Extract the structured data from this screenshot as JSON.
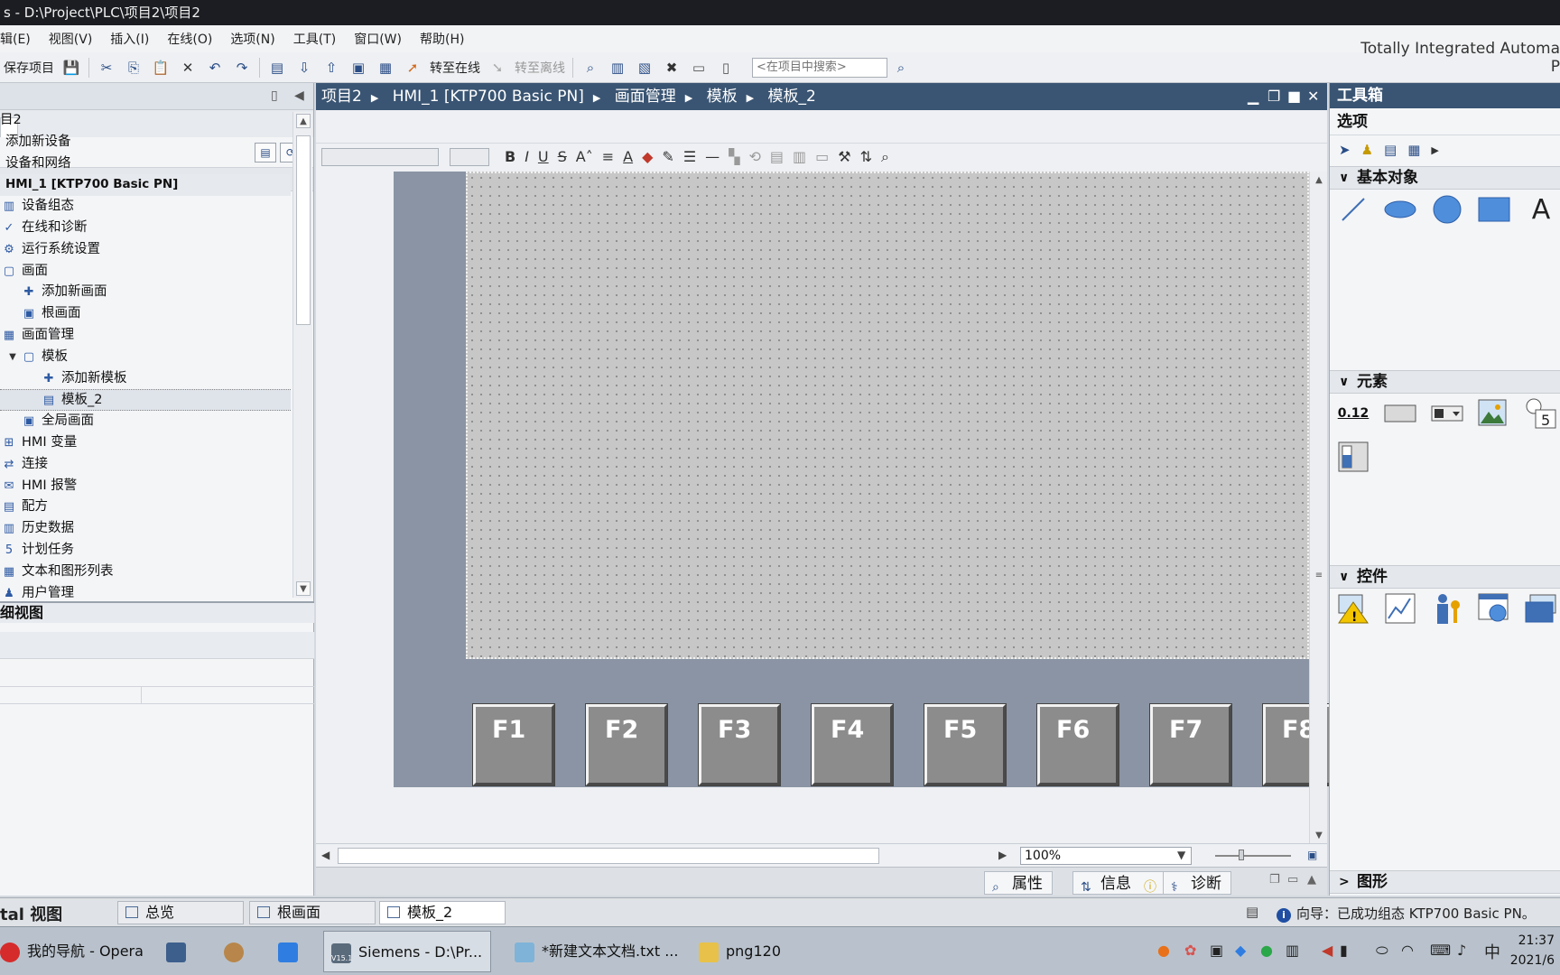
{
  "titlebar": {
    "prefix": "s  -  ",
    "path": "D:\\Project\\PLC\\项目2\\项目2"
  },
  "brand": {
    "line1": "Totally Integrated Automa",
    "line2": "P"
  },
  "menu": [
    "辑(E)",
    "视图(V)",
    "插入(I)",
    "在线(O)",
    "选项(N)",
    "工具(T)",
    "窗口(W)",
    "帮助(H)"
  ],
  "toolbar": {
    "save": "保存项目",
    "go_online": "转至在线",
    "go_offline": "转至离线",
    "search_placeholder": "<在项目中搜索>"
  },
  "tree": {
    "root": "目2",
    "items": [
      {
        "label": "添加新设备",
        "indent": 0,
        "icon": "add-device-icon"
      },
      {
        "label": "设备和网络",
        "indent": 0,
        "icon": "network-icon"
      },
      {
        "label": "HMI_1 [KTP700 Basic PN]",
        "indent": 0,
        "icon": "hmi-icon",
        "header": true
      },
      {
        "label": "设备组态",
        "indent": 1,
        "icon": "device-config-icon"
      },
      {
        "label": "在线和诊断",
        "indent": 1,
        "icon": "diagnostics-icon"
      },
      {
        "label": "运行系统设置",
        "indent": 1,
        "icon": "runtime-settings-icon"
      },
      {
        "label": "画面",
        "indent": 1,
        "icon": "folder-icon"
      },
      {
        "label": "添加新画面",
        "indent": 2,
        "icon": "add-screen-icon"
      },
      {
        "label": "根画面",
        "indent": 2,
        "icon": "screen-icon"
      },
      {
        "label": "画面管理",
        "indent": 1,
        "icon": "screen-management-icon"
      },
      {
        "label": "模板",
        "indent": 2,
        "icon": "template-folder-icon",
        "expanded": true
      },
      {
        "label": "添加新模板",
        "indent": 3,
        "icon": "add-template-icon"
      },
      {
        "label": "模板_2",
        "indent": 3,
        "icon": "template-icon",
        "selected": true
      },
      {
        "label": "全局画面",
        "indent": 2,
        "icon": "global-screen-icon"
      },
      {
        "label": "HMI 变量",
        "indent": 1,
        "icon": "hmi-tags-icon"
      },
      {
        "label": "连接",
        "indent": 1,
        "icon": "connection-icon"
      },
      {
        "label": "HMI 报警",
        "indent": 1,
        "icon": "alarm-icon"
      },
      {
        "label": "配方",
        "indent": 1,
        "icon": "recipe-icon"
      },
      {
        "label": "历史数据",
        "indent": 1,
        "icon": "historical-data-icon"
      },
      {
        "label": "计划任务",
        "indent": 1,
        "icon": "scheduler-icon"
      },
      {
        "label": "文本和图形列表",
        "indent": 1,
        "icon": "text-graphic-list-icon"
      },
      {
        "label": "用户管理",
        "indent": 1,
        "icon": "user-management-icon"
      }
    ]
  },
  "detail_view": {
    "title": "细视图"
  },
  "breadcrumb": [
    "项目2",
    "HMI_1 [KTP700 Basic PN]",
    "画面管理",
    "模板",
    "模板_2"
  ],
  "fkeys": [
    "F1",
    "F2",
    "F3",
    "F4",
    "F5",
    "F6",
    "F7",
    "F8"
  ],
  "zoom": {
    "value": "100%"
  },
  "inspector_tabs": {
    "properties": "属性",
    "info": "信息",
    "diagnostics": "诊断"
  },
  "toolbox": {
    "title": "工具箱",
    "options": "选项",
    "sections": {
      "basic": "基本对象",
      "elements": "元素",
      "controls": "控件",
      "graphics": "图形"
    },
    "text_tool": "A",
    "io_field": "0.12",
    "clock_digit": "5"
  },
  "statusbar": {
    "portal": "tal 视图",
    "tabs": [
      "总览",
      "根画面",
      "模板_2"
    ],
    "message": "向导：已成功组态 KTP700 Basic PN。"
  },
  "taskbar": {
    "items": [
      "我的导航 - Opera",
      "Siemens  -  D:\\Pr...",
      "*新建文本文档.txt ...",
      "png120"
    ],
    "tia_badge": "V15.1",
    "ime": "中",
    "time": "21:37",
    "date": "2021/6"
  },
  "colors": {
    "header_bar": "#3a5573",
    "hmi_frame": "#8a94a4",
    "screen_bg": "#c7c7c7",
    "fkey": "#8c8c8c"
  }
}
